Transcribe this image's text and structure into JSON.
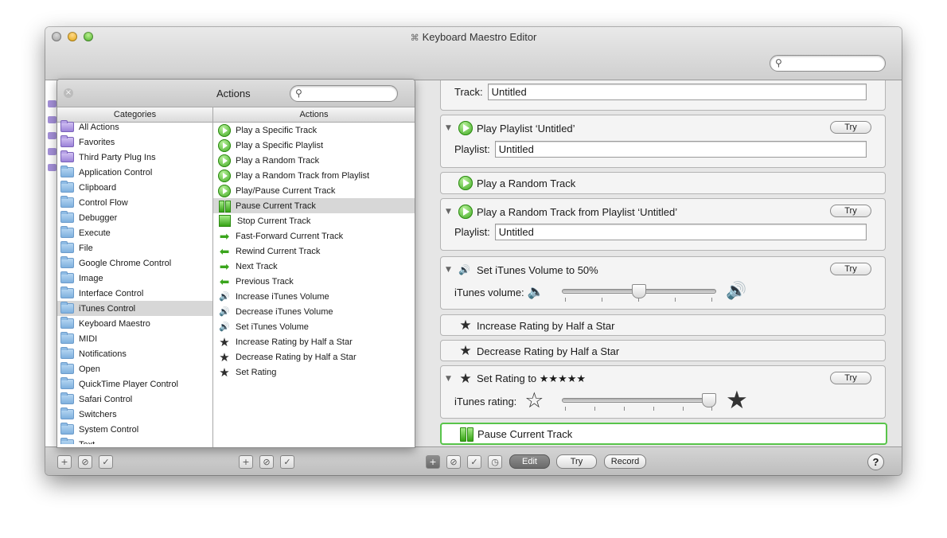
{
  "window": {
    "title": "Keyboard Maestro Editor",
    "title_icon": "cmd-icon",
    "search_placeholder": ""
  },
  "actions_panel": {
    "title": "Actions",
    "search_placeholder": "",
    "categories_header": "Categories",
    "actions_header": "Actions",
    "categories": [
      {
        "label": "All Actions",
        "icon": "purple-folder-icon"
      },
      {
        "label": "Favorites",
        "icon": "purple-folder-icon"
      },
      {
        "label": "Third Party Plug Ins",
        "icon": "purple-folder-icon"
      },
      {
        "label": "Application Control",
        "icon": "folder-icon"
      },
      {
        "label": "Clipboard",
        "icon": "folder-icon"
      },
      {
        "label": "Control Flow",
        "icon": "folder-icon"
      },
      {
        "label": "Debugger",
        "icon": "folder-icon"
      },
      {
        "label": "Execute",
        "icon": "folder-icon"
      },
      {
        "label": "File",
        "icon": "folder-icon"
      },
      {
        "label": "Google Chrome Control",
        "icon": "folder-icon"
      },
      {
        "label": "Image",
        "icon": "folder-icon"
      },
      {
        "label": "Interface Control",
        "icon": "folder-icon"
      },
      {
        "label": "iTunes Control",
        "icon": "folder-icon"
      },
      {
        "label": "Keyboard Maestro",
        "icon": "folder-icon"
      },
      {
        "label": "MIDI",
        "icon": "folder-icon"
      },
      {
        "label": "Notifications",
        "icon": "folder-icon"
      },
      {
        "label": "Open",
        "icon": "folder-icon"
      },
      {
        "label": "QuickTime Player Control",
        "icon": "folder-icon"
      },
      {
        "label": "Safari Control",
        "icon": "folder-icon"
      },
      {
        "label": "Switchers",
        "icon": "folder-icon"
      },
      {
        "label": "System Control",
        "icon": "folder-icon"
      },
      {
        "label": "Text",
        "icon": "folder-icon"
      }
    ],
    "selected_category": "iTunes Control",
    "actions": [
      {
        "label": "Play a Specific Track",
        "icon": "play-icon"
      },
      {
        "label": "Play a Specific Playlist",
        "icon": "play-icon"
      },
      {
        "label": "Play a Random Track",
        "icon": "play-icon"
      },
      {
        "label": "Play a Random Track from Playlist",
        "icon": "play-icon"
      },
      {
        "label": "Play/Pause Current Track",
        "icon": "play-icon"
      },
      {
        "label": "Pause Current Track",
        "icon": "pause-icon"
      },
      {
        "label": "Stop Current Track",
        "icon": "stop-icon"
      },
      {
        "label": "Fast-Forward Current Track",
        "icon": "forward-arrow-icon"
      },
      {
        "label": "Rewind Current Track",
        "icon": "rewind-arrow-icon"
      },
      {
        "label": "Next Track",
        "icon": "forward-arrow-icon"
      },
      {
        "label": "Previous Track",
        "icon": "rewind-arrow-icon"
      },
      {
        "label": "Increase iTunes Volume",
        "icon": "volume-icon"
      },
      {
        "label": "Decrease iTunes Volume",
        "icon": "volume-icon"
      },
      {
        "label": "Set iTunes Volume",
        "icon": "volume-icon"
      },
      {
        "label": "Increase Rating by Half a Star",
        "icon": "star-icon"
      },
      {
        "label": "Decrease Rating by Half a Star",
        "icon": "star-icon"
      },
      {
        "label": "Set Rating",
        "icon": "star-icon"
      }
    ],
    "selected_action": "Pause Current Track"
  },
  "macro": {
    "try_label": "Try",
    "cards": {
      "track_partial": {
        "field_label": "Track:",
        "field_value": "Untitled"
      },
      "play_playlist": {
        "title": "Play Playlist ‘Untitled’",
        "field_label": "Playlist:",
        "field_value": "Untitled"
      },
      "play_random": {
        "title": "Play a Random Track"
      },
      "play_random_from_playlist": {
        "title": "Play a Random Track from Playlist ‘Untitled’",
        "field_label": "Playlist:",
        "field_value": "Untitled"
      },
      "set_volume": {
        "title": "Set iTunes Volume to 50%",
        "slider_label": "iTunes volume:",
        "value_percent": 50
      },
      "increase_rating": {
        "title": "Increase Rating by Half a Star"
      },
      "decrease_rating": {
        "title": "Decrease Rating by Half a Star"
      },
      "set_rating": {
        "title": "Set Rating to ★★★★★",
        "slider_label": "iTunes rating:",
        "value_stars": 5
      },
      "pause_current": {
        "title": "Pause Current Track"
      }
    }
  },
  "bottombar": {
    "edit_label": "Edit",
    "try_label": "Try",
    "record_label": "Record",
    "help_label": "?"
  },
  "colors": {
    "selection_outline": "#58c44a",
    "play_green": "#3aa51c"
  }
}
